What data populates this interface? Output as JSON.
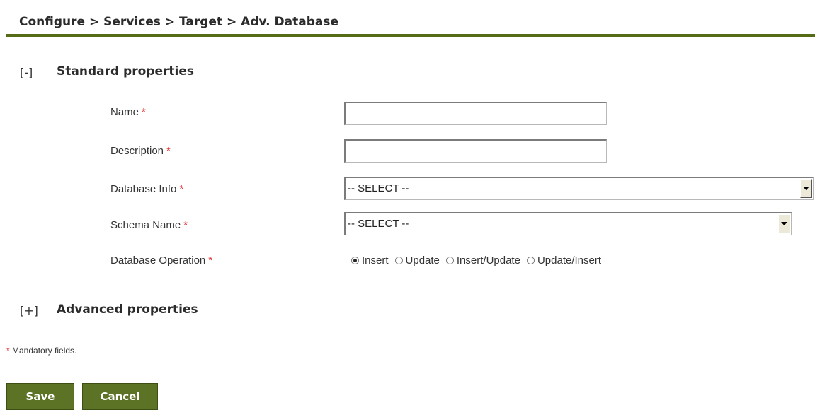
{
  "header": {
    "breadcrumb": "Configure > Services > Target > Adv. Database"
  },
  "standard_section": {
    "toggle": "[-]",
    "title": "Standard properties"
  },
  "fields": {
    "name": {
      "label": "Name",
      "value": ""
    },
    "description": {
      "label": "Description",
      "value": ""
    },
    "database_info": {
      "label": "Database Info",
      "selected": "-- SELECT --"
    },
    "schema_name": {
      "label": "Schema Name",
      "selected": "-- SELECT --"
    },
    "database_operation": {
      "label": "Database Operation",
      "options": [
        "Insert",
        "Update",
        "Insert/Update",
        "Update/Insert"
      ],
      "selected": "Insert"
    },
    "required_marker": "*"
  },
  "advanced_section": {
    "toggle": "[+]",
    "title": "Advanced properties"
  },
  "mandatory_note": {
    "marker": "*",
    "text": " Mandatory fields."
  },
  "buttons": {
    "save": "Save",
    "cancel": "Cancel"
  },
  "colors": {
    "accent": "#556b16",
    "button_bg": "#5c7325",
    "required": "#e03030"
  },
  "icons": {
    "select_arrow": "chevron-down-icon"
  }
}
